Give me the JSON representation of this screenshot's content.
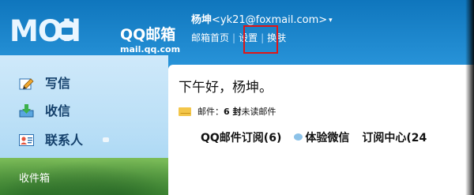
{
  "logo": {
    "wordmark": "MOil",
    "title": "QQ邮箱",
    "domain": "mail.qq.com"
  },
  "header": {
    "user_name": "杨坤",
    "user_email": "<yk21@foxmail.com>",
    "caret": "▾",
    "links": [
      "邮箱首页",
      "设置",
      "换肤"
    ],
    "separator": "|"
  },
  "sidebar": {
    "items": [
      {
        "label": "写信",
        "icon": "pencil-icon"
      },
      {
        "label": "收信",
        "icon": "inbox-download-icon"
      },
      {
        "label": "联系人",
        "icon": "contact-card-icon"
      }
    ],
    "section_title": "收件箱"
  },
  "main": {
    "greeting": "下午好，杨坤。",
    "mail_label": "邮件：",
    "mail_count": "6 封",
    "mail_unread": "未读邮件",
    "subscribe": "QQ邮件订阅(6)",
    "wechat": "体验微信",
    "sub_center": "订阅中心(24"
  },
  "colors": {
    "header_bg": "#1a82c7",
    "highlight": "#e01616",
    "nav_text": "#14406b"
  }
}
